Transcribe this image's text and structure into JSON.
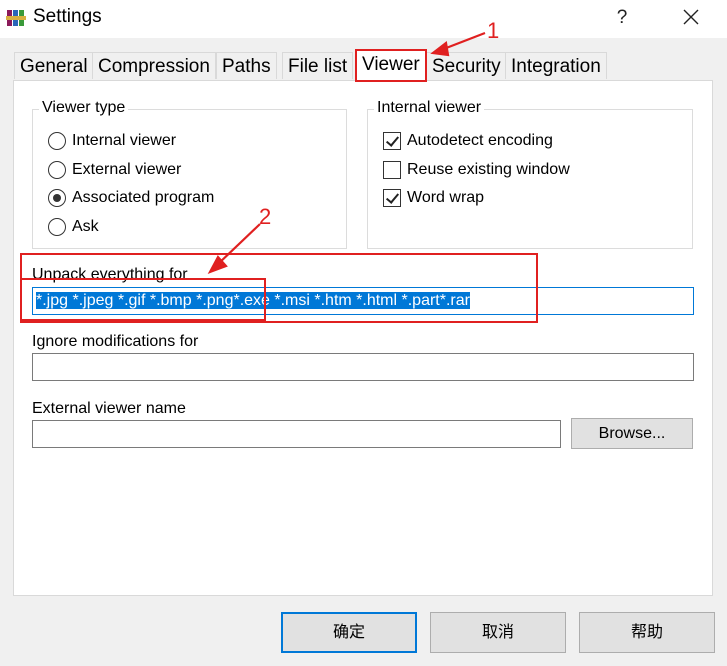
{
  "window": {
    "title": "Settings",
    "help_glyph": "?"
  },
  "tabs": [
    {
      "label": "General"
    },
    {
      "label": "Compression"
    },
    {
      "label": "Paths"
    },
    {
      "label": "File list"
    },
    {
      "label": "Viewer"
    },
    {
      "label": "Security"
    },
    {
      "label": "Integration"
    }
  ],
  "active_tab": "Viewer",
  "viewer_type": {
    "legend": "Viewer type",
    "options": [
      {
        "label": "Internal viewer",
        "selected": false
      },
      {
        "label": "External viewer",
        "selected": false
      },
      {
        "label": "Associated program",
        "selected": true
      },
      {
        "label": "Ask",
        "selected": false
      }
    ]
  },
  "internal_viewer": {
    "legend": "Internal viewer",
    "options": [
      {
        "label": "Autodetect encoding",
        "checked": true
      },
      {
        "label": "Reuse existing window",
        "checked": false
      },
      {
        "label": "Word wrap",
        "checked": true
      }
    ]
  },
  "unpack": {
    "label": "Unpack everything for",
    "value": "*.jpg *.jpeg *.gif *.bmp *.png*.exe *.msi *.htm *.html *.part*.rar"
  },
  "ignore": {
    "label": "Ignore modifications for",
    "value": ""
  },
  "external_viewer": {
    "label": "External viewer name",
    "value": "",
    "browse_label": "Browse..."
  },
  "footer": {
    "ok_label": "确定",
    "cancel_label": "取消",
    "help_label": "帮助"
  },
  "annotations": {
    "label_1": "1",
    "label_2": "2",
    "color": "#e02020"
  },
  "colors": {
    "accent": "#0078d7",
    "selection": "#0078d7"
  }
}
